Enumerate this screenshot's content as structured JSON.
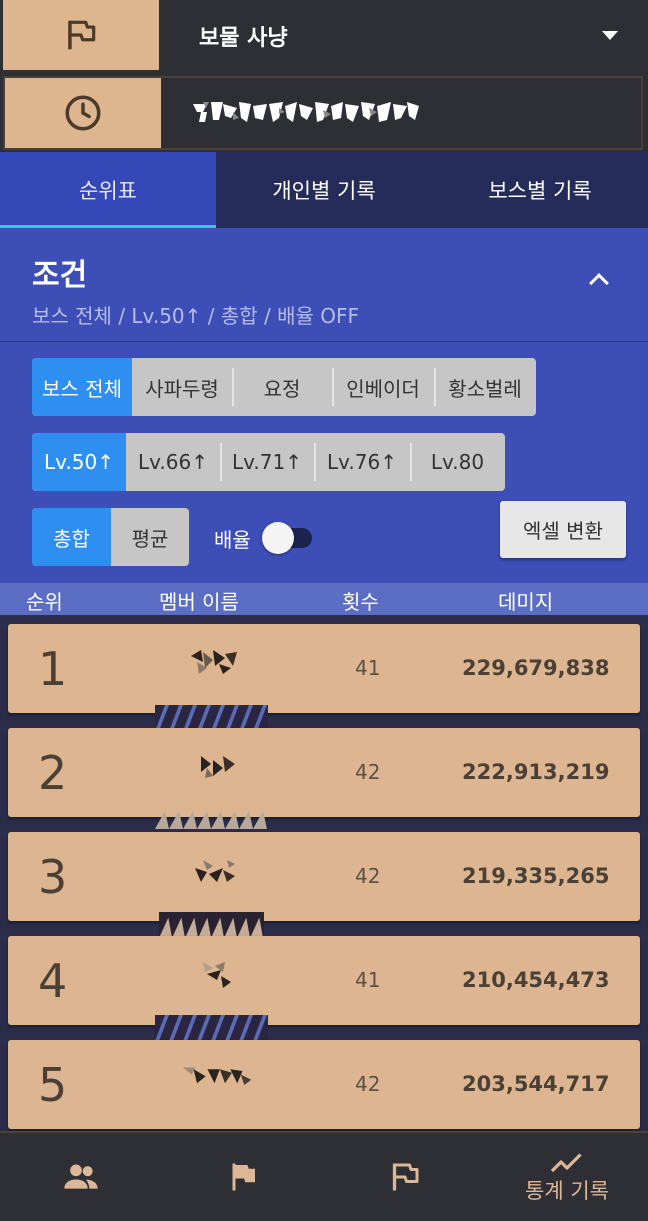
{
  "header": {
    "title": "보물 사냥",
    "flag_icon": "flag-outline-icon",
    "clock_icon": "clock-icon",
    "dropdown_icon": "caret-down-icon"
  },
  "tabs": [
    {
      "label": "순위표",
      "active": true
    },
    {
      "label": "개인별 기록",
      "active": false
    },
    {
      "label": "보스별 기록",
      "active": false
    }
  ],
  "condition": {
    "title": "조건",
    "summary": "보스 전체 / Lv.50↑ / 총합 / 배율 OFF",
    "boss_filter": [
      "보스 전체",
      "사파두령",
      "요정",
      "인베이더",
      "황소벌레"
    ],
    "boss_selected": 0,
    "level_filter": [
      "Lv.50↑",
      "Lv.66↑",
      "Lv.71↑",
      "Lv.76↑",
      "Lv.80"
    ],
    "level_selected": 0,
    "mode_filter": [
      "총합",
      "평균"
    ],
    "mode_selected": 0,
    "multiplier_label": "배율",
    "multiplier_on": false,
    "excel_button": "엑셀 변환"
  },
  "table": {
    "headers": [
      "순위",
      "멤버 이름",
      "횟수",
      "데미지"
    ],
    "rows": [
      {
        "rank": "1",
        "count": "41",
        "damage": "229,679,838"
      },
      {
        "rank": "2",
        "count": "42",
        "damage": "222,913,219"
      },
      {
        "rank": "3",
        "count": "42",
        "damage": "219,335,265"
      },
      {
        "rank": "4",
        "count": "41",
        "damage": "210,454,473"
      },
      {
        "rank": "5",
        "count": "42",
        "damage": "203,544,717"
      }
    ]
  },
  "bottom_nav": [
    {
      "label": "",
      "icon": "members-icon"
    },
    {
      "label": "",
      "icon": "flag-icon"
    },
    {
      "label": "",
      "icon": "flag-outline-icon"
    },
    {
      "label": "통계 기록",
      "icon": "trend-line-icon",
      "active": true
    }
  ],
  "colors": {
    "accent_tan": "#ddb58e",
    "tab_active": "#3448b8",
    "tab_indicator": "#2ec9e8",
    "segment_active": "#2e8ff0"
  }
}
